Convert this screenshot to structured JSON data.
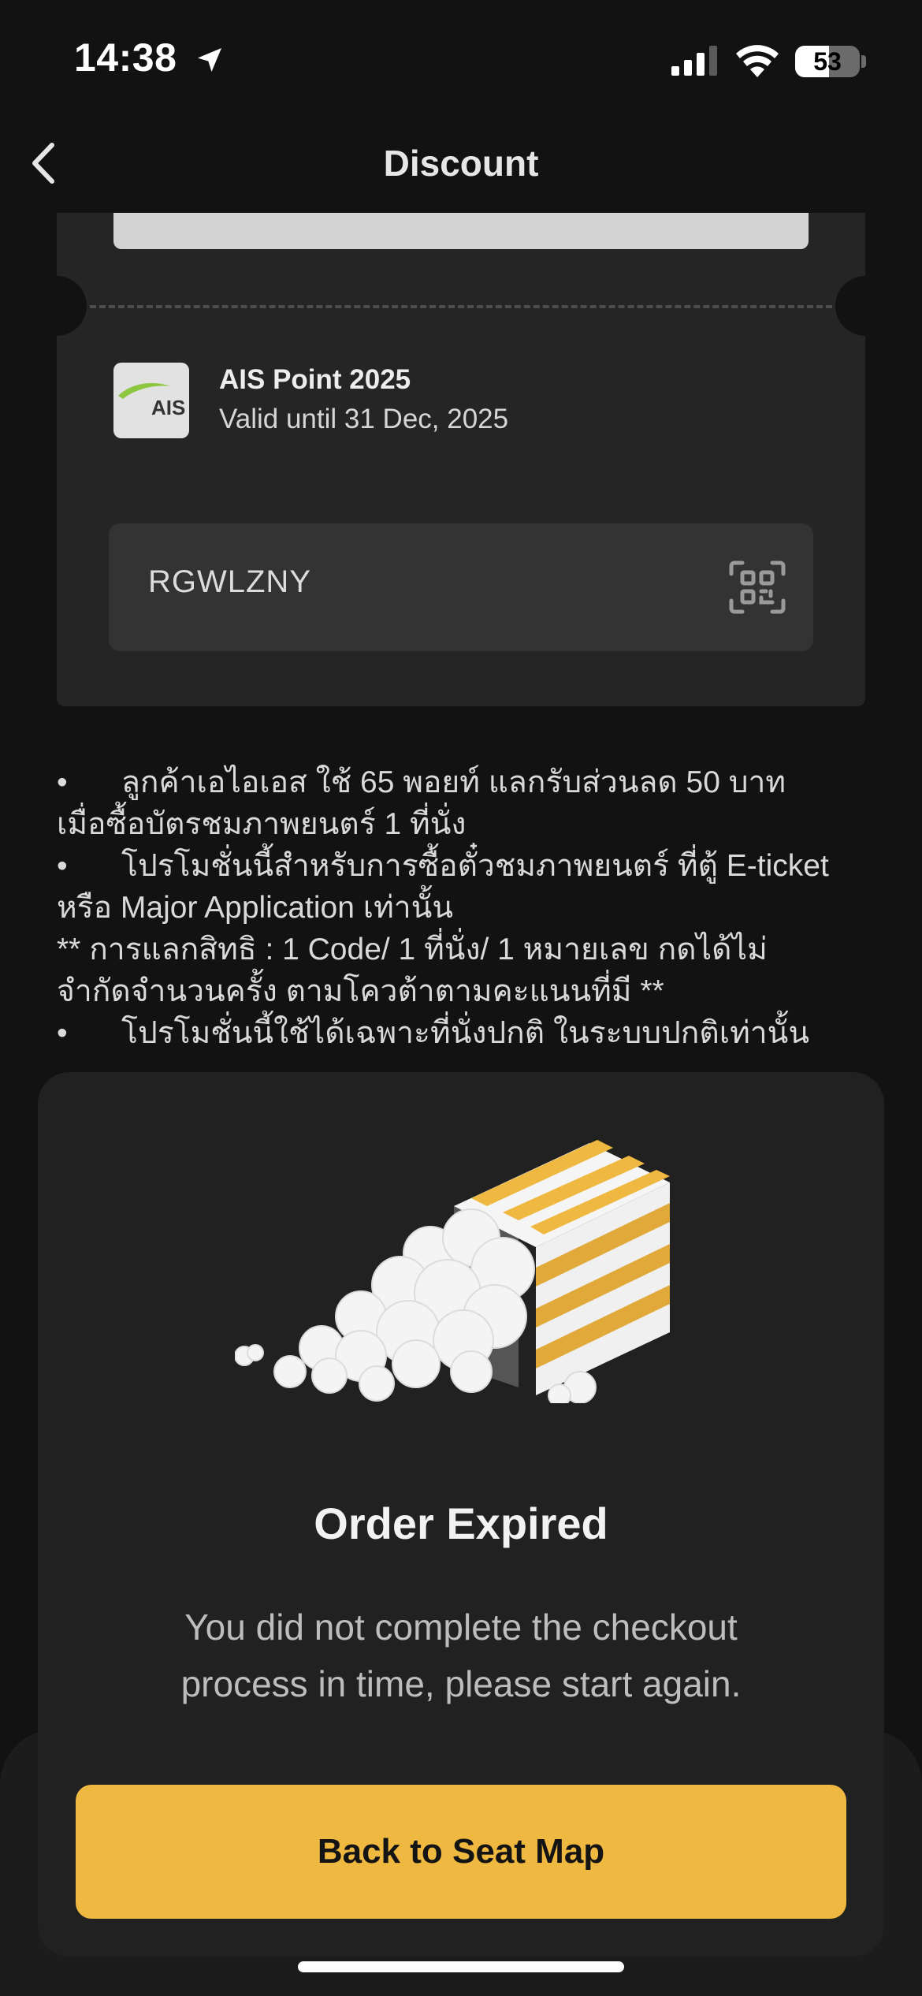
{
  "status_bar": {
    "time": "14:38",
    "battery": "53",
    "battery_level": 0.53
  },
  "nav": {
    "title": "Discount",
    "back_icon": "chevron-left-icon"
  },
  "promo": {
    "logo_text": "AIS",
    "title": "AIS Point 2025",
    "valid_until": "Valid until 31 Dec, 2025",
    "code": "RGWLZNY",
    "code_icon": "qr-scan-icon"
  },
  "terms": {
    "lines": [
      "•\tลูกค้าเอไอเอส ใช้ 65 พอยท์ แลกรับส่วนลด 50 บาท",
      "เมื่อซื้อบัตรชมภาพยนตร์ 1 ที่นั่ง",
      "•\tโปรโมชั่นนี้สำหรับการซื้อตั๋วชมภาพยนตร์ ที่ตู้ E-ticket",
      "หรือ Major Application เท่านั้น",
      "** การแลกสิทธิ : 1 Code/ 1 ที่นั่ง/ 1 หมายเลข กดได้ไม่",
      "จำกัดจำนวนครั้ง ตามโควต้าตามคะแนนที่มี **",
      "•\tโปรโมชั่นนี้ใช้ได้เฉพาะที่นั่งปกติ ในระบบปกติเท่านั้น"
    ]
  },
  "modal": {
    "illustration": "spilled-popcorn-icon",
    "title": "Order Expired",
    "message_line1": "You did not complete the checkout",
    "message_line2": "process in time, please start again.",
    "button_label": "Back to Seat Map"
  },
  "colors": {
    "background": "#121212",
    "card": "#252525",
    "modal": "#212121",
    "accent": "#efb840"
  }
}
